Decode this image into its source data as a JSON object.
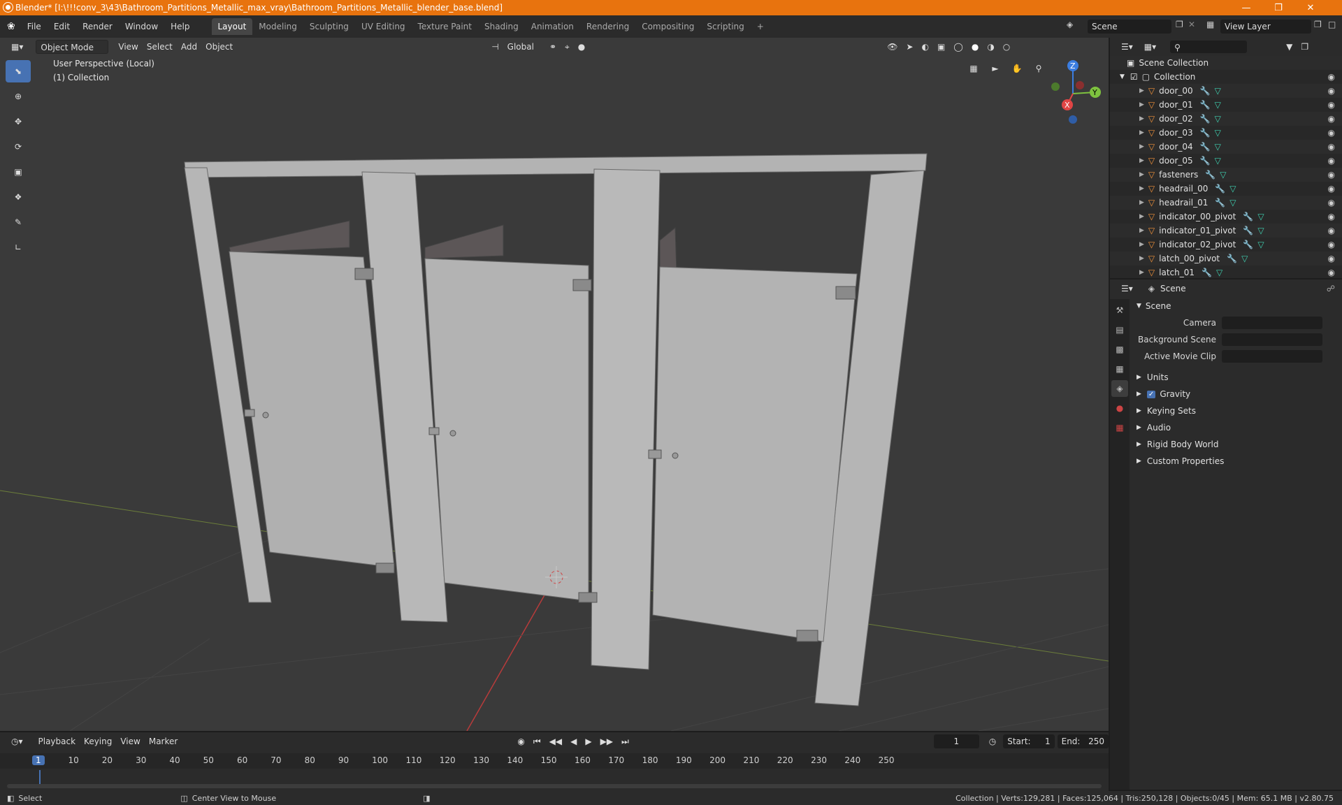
{
  "window": {
    "title": "Blender* [I:\\!!!conv_3\\43\\Bathroom_Partitions_Metallic_max_vray\\Bathroom_Partitions_Metallic_blender_base.blend]"
  },
  "menus": [
    "File",
    "Edit",
    "Render",
    "Window",
    "Help"
  ],
  "workspaces": [
    "Layout",
    "Modeling",
    "Sculpting",
    "UV Editing",
    "Texture Paint",
    "Shading",
    "Animation",
    "Rendering",
    "Compositing",
    "Scripting"
  ],
  "workspace_add": "+",
  "scene_field": "Scene",
  "viewlayer_field": "View Layer",
  "viewport": {
    "mode": "Object Mode",
    "menus": [
      "View",
      "Select",
      "Add",
      "Object"
    ],
    "transform": "Global",
    "view_label": "User Perspective (Local)",
    "collection_label": "(1) Collection"
  },
  "gizmo": {
    "x": "X",
    "y": "Y",
    "z": "Z"
  },
  "outliner": {
    "root": "Scene Collection",
    "collection": "Collection",
    "items": [
      "door_00",
      "door_01",
      "door_02",
      "door_03",
      "door_04",
      "door_05",
      "fasteners",
      "headrail_00",
      "headrail_01",
      "indicator_00_pivot",
      "indicator_01_pivot",
      "indicator_02_pivot",
      "latch_00_pivot",
      "latch_01"
    ]
  },
  "properties": {
    "context": "Scene",
    "panel": "Scene",
    "fields": [
      {
        "label": "Camera"
      },
      {
        "label": "Background Scene"
      },
      {
        "label": "Active Movie Clip"
      }
    ],
    "subpanels": [
      "Units",
      "Gravity",
      "Keying Sets",
      "Audio",
      "Rigid Body World",
      "Custom Properties"
    ]
  },
  "timeline": {
    "menus": [
      "Playback",
      "Keying",
      "View",
      "Marker"
    ],
    "current_frame": "1",
    "start_label": "Start:",
    "start": "1",
    "end_label": "End:",
    "end": "250",
    "ticks": [
      "1",
      "10",
      "20",
      "30",
      "40",
      "50",
      "60",
      "70",
      "80",
      "90",
      "100",
      "110",
      "120",
      "130",
      "140",
      "150",
      "160",
      "170",
      "180",
      "190",
      "200",
      "210",
      "220",
      "230",
      "240",
      "250"
    ]
  },
  "status": {
    "select": "Select",
    "center": "Center View to Mouse",
    "stats": "Collection | Verts:129,281 | Faces:125,064 | Tris:250,128 | Objects:0/45 | Mem: 65.1 MB | v2.80.75"
  }
}
